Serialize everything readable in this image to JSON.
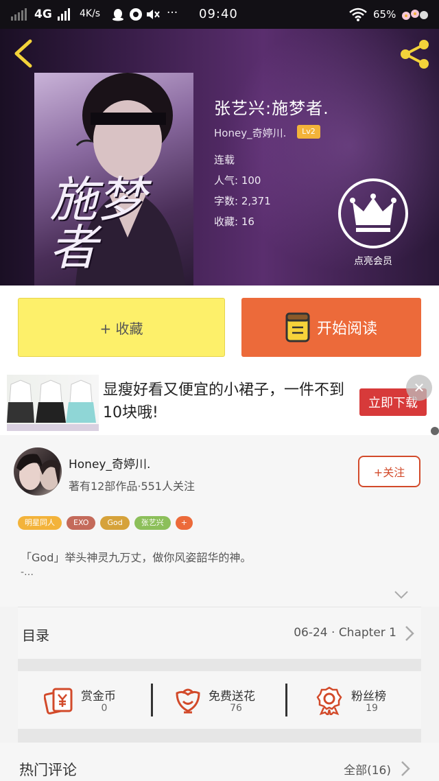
{
  "status_bar": {
    "network": "4G",
    "speed": "4K/s",
    "dots": "···",
    "time": "09:40",
    "battery": "65%"
  },
  "book": {
    "cover_art_title": "施梦者",
    "title": "张艺兴:施梦者.",
    "author": "Honey_奇婷川.",
    "level": "Lv2",
    "status": "连载",
    "popularity": "人气: 100",
    "word_count": "字数: 2,371",
    "favorites": "收藏: 16",
    "vip_label": "点亮会员"
  },
  "actions": {
    "favorite_label": "+ 收藏",
    "read_label": "开始阅读"
  },
  "ad": {
    "text": "显瘦好看又便宜的小裙子，一件不到10块哦!",
    "cta": "立即下载",
    "close": "✕"
  },
  "author_card": {
    "name": "Honey_奇婷川.",
    "stats": "著有12部作品·551人关注",
    "follow_label": "+关注",
    "tags": [
      {
        "label": "明星同人",
        "color": "#f3b33a"
      },
      {
        "label": "EXO",
        "color": "#c46a5a"
      },
      {
        "label": "God",
        "color": "#d6a23a"
      },
      {
        "label": "张艺兴",
        "color": "#8cbf5a"
      },
      {
        "label": "+",
        "color": "#ec6a3a"
      }
    ],
    "intro": "「God」举头神灵九万丈，做你风姿韶华的神。",
    "intro_more": "-…"
  },
  "catalog": {
    "label": "目录",
    "latest": "06-24 · Chapter 1"
  },
  "stats": {
    "coins_label": "赏金币",
    "coins_value": "0",
    "flowers_label": "免费送花",
    "flowers_value": "76",
    "fans_label": "粉丝榜",
    "fans_value": "19"
  },
  "comments": {
    "label": "热门评论",
    "all": "全部(16)"
  },
  "colors": {
    "accent_orange": "#ec6a3a",
    "favorite_yellow": "#fdf06a",
    "icon_red": "#d24a2a"
  }
}
